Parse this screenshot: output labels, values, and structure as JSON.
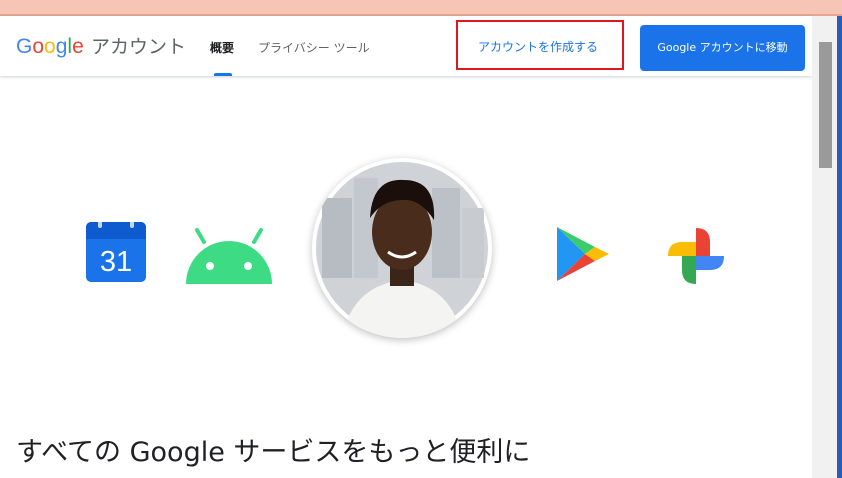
{
  "header": {
    "logo_text": "Google",
    "logo_subtitle": "アカウント",
    "tabs": [
      {
        "label": "概要",
        "active": true
      },
      {
        "label": "プライバシー ツール",
        "active": false
      }
    ],
    "create_account_link": "アカウントを作成する",
    "go_to_account_button": "Google アカウントに移動"
  },
  "hero": {
    "icons": [
      "calendar-icon",
      "android-icon",
      "play-store-icon",
      "photos-icon"
    ],
    "calendar_day": "31"
  },
  "main": {
    "headline": "すべての Google サービスをもっと便利に"
  },
  "colors": {
    "accent_blue": "#1a73e8",
    "highlight_box": "#e0171f",
    "top_strip": "#f6c5b5"
  }
}
